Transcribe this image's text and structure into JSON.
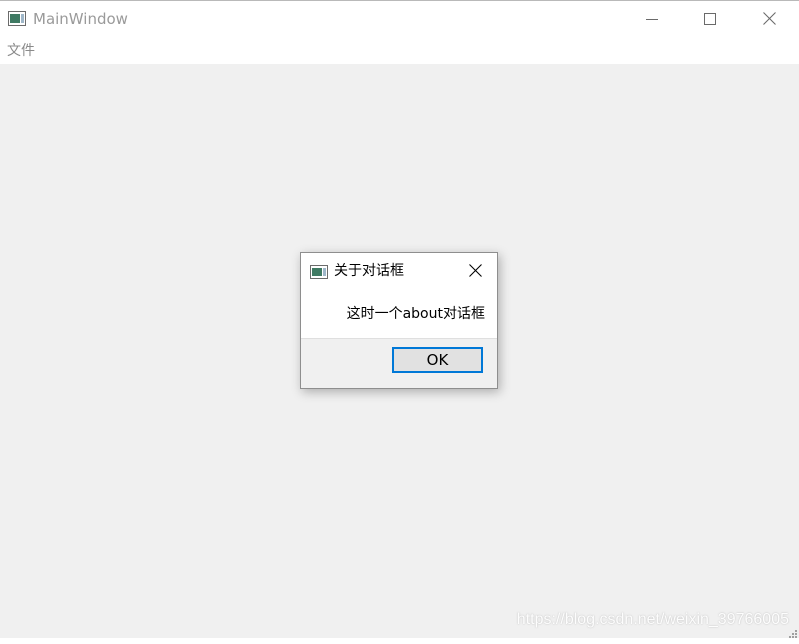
{
  "window": {
    "title": "MainWindow",
    "icon": "app-window-icon",
    "controls": [
      "minimize-icon",
      "maximize-icon",
      "close-icon"
    ]
  },
  "menubar": {
    "items": [
      {
        "label": "文件"
      }
    ]
  },
  "dialog": {
    "title": "关于对话框",
    "icon": "app-window-icon",
    "message": "这时一个about对话框",
    "ok_label": "OK",
    "accent_color": "#0078d7"
  },
  "watermark": "https://blog.csdn.net/weixin_39766005"
}
